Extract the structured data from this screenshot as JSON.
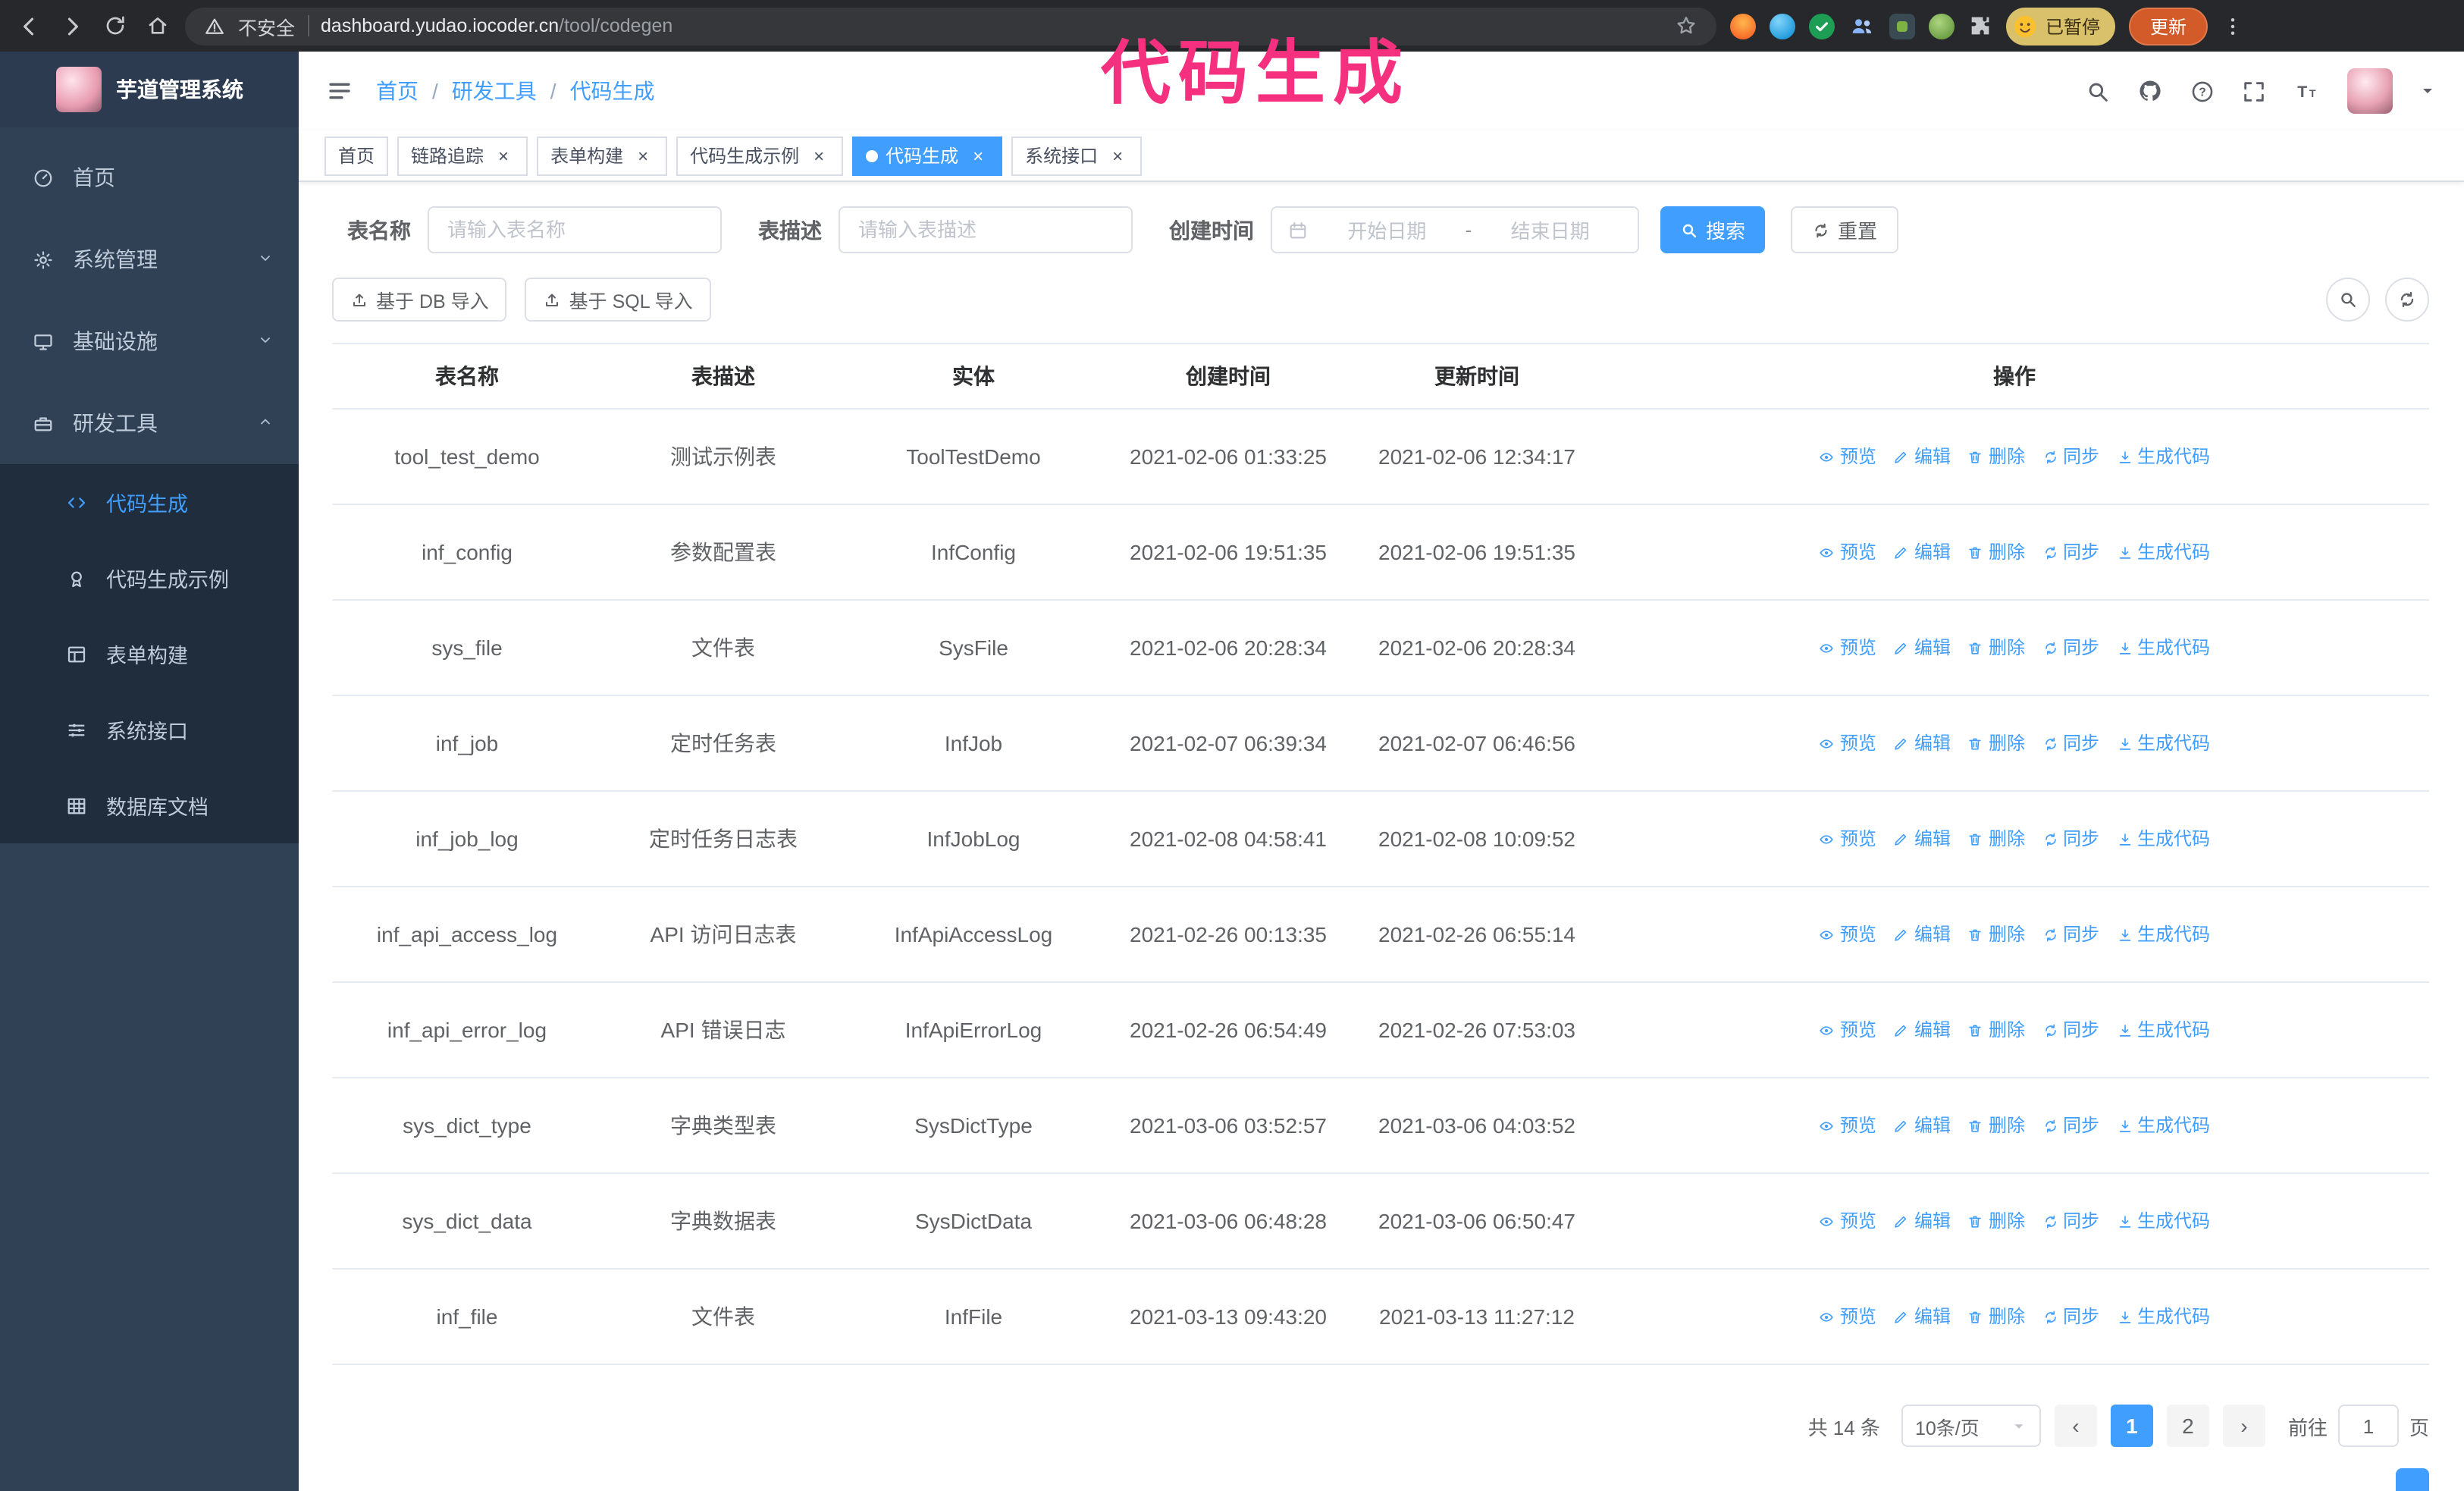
{
  "theme": {
    "accent_color": "#409eff",
    "sidebar_color": "#304156",
    "submenu_color": "#1f2d3d"
  },
  "annotation": {
    "text": "代码生成",
    "color": "#f5317f"
  },
  "browser": {
    "security_label": "不安全",
    "url_host": "dashboard.yudao.iocoder.cn",
    "url_path": "/tool/codegen",
    "paused_badge": "已暂停",
    "update_button": "更新"
  },
  "sidebar": {
    "app_title": "芋道管理系统",
    "menu": [
      {
        "id": "home",
        "icon": "dashboard-icon",
        "label": "首页"
      },
      {
        "id": "system-management",
        "icon": "gear-icon",
        "label": "系统管理",
        "chevron": "down"
      },
      {
        "id": "infrastructure",
        "icon": "monitor-icon",
        "label": "基础设施",
        "chevron": "down"
      },
      {
        "id": "dev-tools",
        "icon": "toolbox-icon",
        "label": "研发工具",
        "chevron": "up",
        "children": [
          {
            "id": "codegen",
            "icon": "code-icon",
            "label": "代码生成",
            "active": true
          },
          {
            "id": "codegen-example",
            "icon": "badge-icon",
            "label": "代码生成示例"
          },
          {
            "id": "form-builder",
            "icon": "form-icon",
            "label": "表单构建"
          },
          {
            "id": "system-api",
            "icon": "sliders-icon",
            "label": "系统接口"
          },
          {
            "id": "db-doc",
            "icon": "table-grid-icon",
            "label": "数据库文档"
          }
        ]
      }
    ]
  },
  "header": {
    "breadcrumb": [
      "首页",
      "研发工具",
      "代码生成"
    ]
  },
  "tabs": [
    {
      "id": "home",
      "label": "首页",
      "closable": false,
      "active": false
    },
    {
      "id": "tracing",
      "label": "链路追踪",
      "closable": true,
      "active": false
    },
    {
      "id": "form-builder",
      "label": "表单构建",
      "closable": true,
      "active": false
    },
    {
      "id": "codegen-example",
      "label": "代码生成示例",
      "closable": true,
      "active": false
    },
    {
      "id": "codegen",
      "label": "代码生成",
      "closable": true,
      "active": true
    },
    {
      "id": "system-api",
      "label": "系统接口",
      "closable": true,
      "active": false
    }
  ],
  "filters": {
    "table_name_label": "表名称",
    "table_name_placeholder": "请输入表名称",
    "table_desc_label": "表描述",
    "table_desc_placeholder": "请输入表描述",
    "create_time_label": "创建时间",
    "date_start_placeholder": "开始日期",
    "date_separator": "-",
    "date_end_placeholder": "结束日期",
    "search_button": "搜索",
    "reset_button": "重置"
  },
  "toolbar": {
    "import_db_button": "基于 DB 导入",
    "import_sql_button": "基于 SQL 导入"
  },
  "table": {
    "columns": [
      "表名称",
      "表描述",
      "实体",
      "创建时间",
      "更新时间",
      "操作"
    ],
    "actions": [
      {
        "id": "preview",
        "icon": "eye-icon",
        "label": "预览"
      },
      {
        "id": "edit",
        "icon": "edit-icon",
        "label": "编辑"
      },
      {
        "id": "delete",
        "icon": "delete-icon",
        "label": "删除"
      },
      {
        "id": "sync",
        "icon": "sync-icon",
        "label": "同步"
      },
      {
        "id": "generate",
        "icon": "generate-icon",
        "label": "生成代码"
      }
    ],
    "rows": [
      {
        "name": "tool_test_demo",
        "desc": "测试示例表",
        "entity": "ToolTestDemo",
        "created": "2021-02-06 01:33:25",
        "updated": "2021-02-06 12:34:17"
      },
      {
        "name": "inf_config",
        "desc": "参数配置表",
        "entity": "InfConfig",
        "created": "2021-02-06 19:51:35",
        "updated": "2021-02-06 19:51:35"
      },
      {
        "name": "sys_file",
        "desc": "文件表",
        "entity": "SysFile",
        "created": "2021-02-06 20:28:34",
        "updated": "2021-02-06 20:28:34"
      },
      {
        "name": "inf_job",
        "desc": "定时任务表",
        "entity": "InfJob",
        "created": "2021-02-07 06:39:34",
        "updated": "2021-02-07 06:46:56"
      },
      {
        "name": "inf_job_log",
        "desc": "定时任务日志表",
        "entity": "InfJobLog",
        "created": "2021-02-08 04:58:41",
        "updated": "2021-02-08 10:09:52"
      },
      {
        "name": "inf_api_access_log",
        "desc": "API 访问日志表",
        "entity": "InfApiAccessLog",
        "created": "2021-02-26 00:13:35",
        "updated": "2021-02-26 06:55:14"
      },
      {
        "name": "inf_api_error_log",
        "desc": "API 错误日志",
        "entity": "InfApiErrorLog",
        "created": "2021-02-26 06:54:49",
        "updated": "2021-02-26 07:53:03"
      },
      {
        "name": "sys_dict_type",
        "desc": "字典类型表",
        "entity": "SysDictType",
        "created": "2021-03-06 03:52:57",
        "updated": "2021-03-06 04:03:52"
      },
      {
        "name": "sys_dict_data",
        "desc": "字典数据表",
        "entity": "SysDictData",
        "created": "2021-03-06 06:48:28",
        "updated": "2021-03-06 06:50:47"
      },
      {
        "name": "inf_file",
        "desc": "文件表",
        "entity": "InfFile",
        "created": "2021-03-13 09:43:20",
        "updated": "2021-03-13 11:27:12"
      }
    ]
  },
  "pagination": {
    "total_text": "共 14 条",
    "page_size_label": "10条/页",
    "pages": [
      {
        "label": "1",
        "active": true
      },
      {
        "label": "2",
        "active": false
      }
    ],
    "goto_prefix": "前往",
    "goto_value": "1",
    "goto_suffix": "页"
  }
}
